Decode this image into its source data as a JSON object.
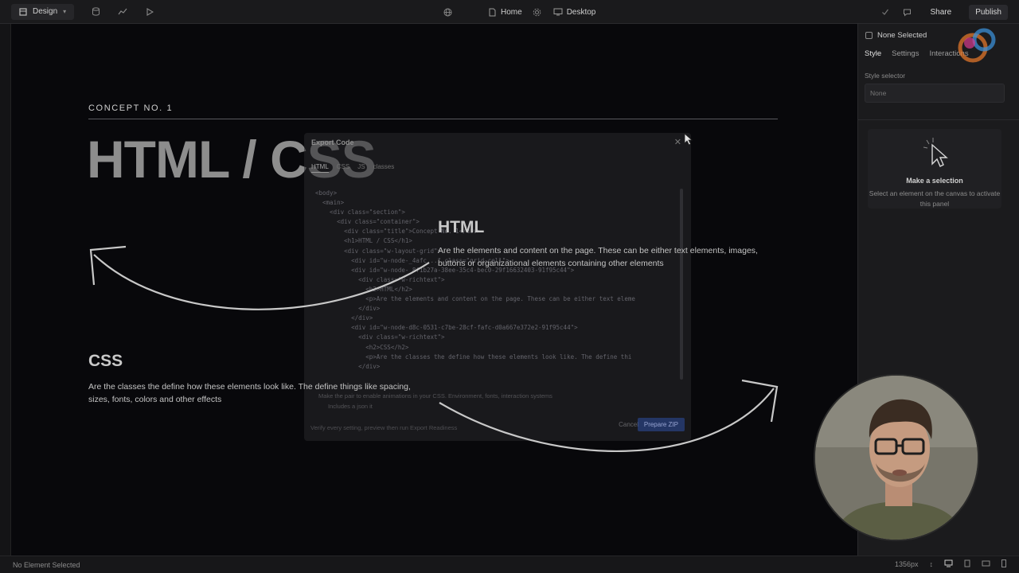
{
  "topbar": {
    "design_label": "Design",
    "home_label": "Home",
    "desktop_label": "Desktop",
    "share_label": "Share",
    "publish_label": "Publish"
  },
  "canvas": {
    "concept_label": "CONCEPT NO. 1",
    "big_title": "HTML / CSS",
    "html_heading": "HTML",
    "html_text": "Are the elements and content on the page. These can be either text elements, images, buttons or organizational elements containing other elements",
    "css_heading": "CSS",
    "css_text": "Are the classes the define how these elements look like. The define things like spacing, sizes, fonts, colors and other effects"
  },
  "modal": {
    "title": "Export Code",
    "tabs": [
      "HTML",
      "CSS",
      "JS",
      "classes"
    ],
    "code_lines": [
      "<body>",
      "  <main>",
      "    <div class=\"section\">",
      "      <div class=\"container\">",
      "        <div class=\"title\">Concept No. 1</div>",
      "        <h1>HTML / CSS</h1>",
      "        <div class=\"w-layout-grid\">",
      "          <div id=\"w-node-_4afc...\" class=\"grid-cell\">",
      "          <div id=\"w-node-_8f1b27a-38ee-35c4-bec0-29f16632403-91f95c44\">",
      "            <div class=\"w-richtext\">",
      "              <h2>HTML</h2>",
      "              <p>Are the elements and content on the page. These can be either text eleme",
      "            </div>",
      "          </div>",
      "          <div id=\"w-node-d8c-0531-c7be-28cf-fafc-d0a667e372e2-91f95c44\">",
      "            <div class=\"w-richtext\">",
      "              <h2>CSS</h2>",
      "              <p>Are the classes the define how these elements look like. The define thi",
      "            </div>"
    ],
    "check_1": "Make the pair to enable animations in your CSS. Environment, fonts, interaction systems",
    "check_2": "Includes a json it",
    "footer_text": "Verify every setting, preview then run Export Readiness",
    "cancel_label": "Cancel",
    "prepare_label": "Prepare ZIP"
  },
  "right_panel": {
    "selection_label": "None Selected",
    "tabs": [
      "Style",
      "Settings",
      "Interactions"
    ],
    "style_selector_label": "Style selector",
    "style_selector_placeholder": "None",
    "empty_title": "Make a selection",
    "empty_text": "Select an element on the canvas to activate this panel"
  },
  "statusbar": {
    "left_text": "No Element Selected",
    "width_readout": "1356px"
  },
  "colors": {
    "canvas_bg": "#08080b",
    "panel_bg": "#1b1b1d",
    "accent_blue": "#3a6fd8"
  }
}
